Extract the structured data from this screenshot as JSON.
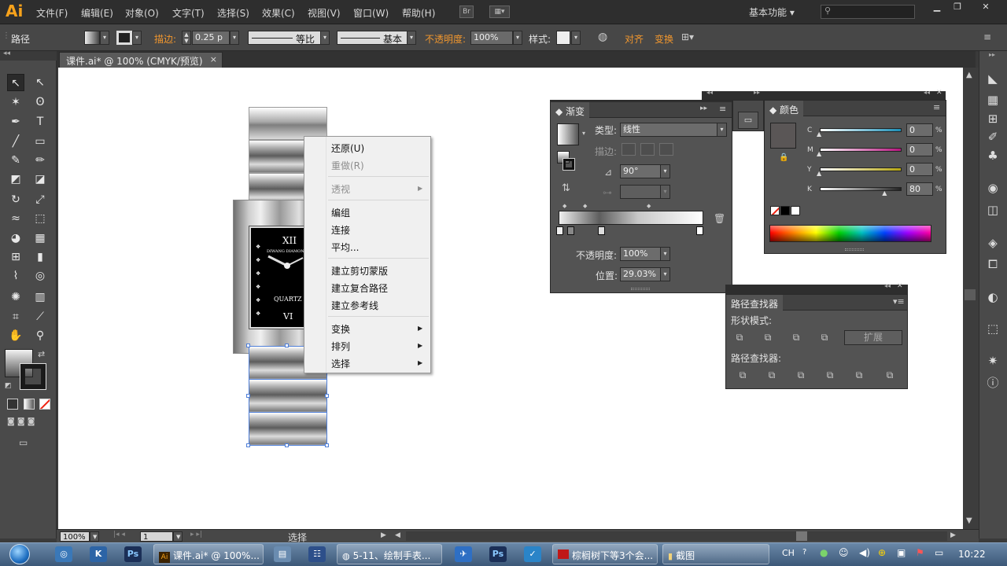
{
  "app": {
    "logo": "Ai"
  },
  "menubar": {
    "items": [
      "文件(F)",
      "编辑(E)",
      "对象(O)",
      "文字(T)",
      "选择(S)",
      "效果(C)",
      "视图(V)",
      "窗口(W)",
      "帮助(H)"
    ],
    "bridge": "Br",
    "workspace": "基本功能",
    "search_placeholder": ""
  },
  "controlbar": {
    "object_type": "路径",
    "stroke_label": "描边:",
    "stroke_value": "0.25 p",
    "profile_label": "等比",
    "brush_label": "基本",
    "opacity_label": "不透明度:",
    "opacity_value": "100%",
    "style_label": "样式:",
    "align_label": "对齐",
    "transform_label": "变换"
  },
  "document": {
    "tab_title": "课件.ai* @ 100% (CMYK/预览)",
    "close_glyph": "×"
  },
  "watch": {
    "numeral_top": "XII",
    "numeral_bottom": "VI",
    "brand": "DIWANG DIAMOND",
    "quartz": "QUARTZ"
  },
  "context_menu": {
    "undo": "还原(U)",
    "redo": "重做(R)",
    "perspective": "透视",
    "group": "编组",
    "join": "连接",
    "average": "平均...",
    "clipping_mask": "建立剪切蒙版",
    "compound_path": "建立复合路径",
    "guides": "建立参考线",
    "transform": "变换",
    "arrange": "排列",
    "select": "选择"
  },
  "gradient_panel": {
    "title": "渐变",
    "type_label": "类型:",
    "type_value": "线性",
    "stroke_label": "描边:",
    "angle_value": "90°",
    "opacity_label": "不透明度:",
    "opacity_value": "100%",
    "location_label": "位置:",
    "location_value": "29.03%"
  },
  "color_panel": {
    "title": "颜色",
    "channels": [
      {
        "name": "C",
        "value": "0",
        "unit": "%",
        "level": 0.0,
        "color": "#1c8fb6"
      },
      {
        "name": "M",
        "value": "0",
        "unit": "%",
        "level": 0.0,
        "color": "#b6157e"
      },
      {
        "name": "Y",
        "value": "0",
        "unit": "%",
        "level": 0.0,
        "color": "#b6a611"
      },
      {
        "name": "K",
        "value": "80",
        "unit": "%",
        "level": 0.8,
        "color": "#222222"
      }
    ],
    "swatch_color": "#5a5656"
  },
  "pathfinder_panel": {
    "title": "路径查找器",
    "shape_modes_label": "形状模式:",
    "expand_label": "扩展",
    "pathfinders_label": "路径查找器:"
  },
  "statusbar": {
    "zoom": "100%",
    "page": "1",
    "tool": "选择"
  },
  "taskbar": {
    "buttons": [
      "课件.ai* @ 100%...",
      "5-11、绘制手表...",
      "棕榈树下等3个会...",
      "截图"
    ],
    "lang": "CH",
    "clock": "10:22"
  }
}
